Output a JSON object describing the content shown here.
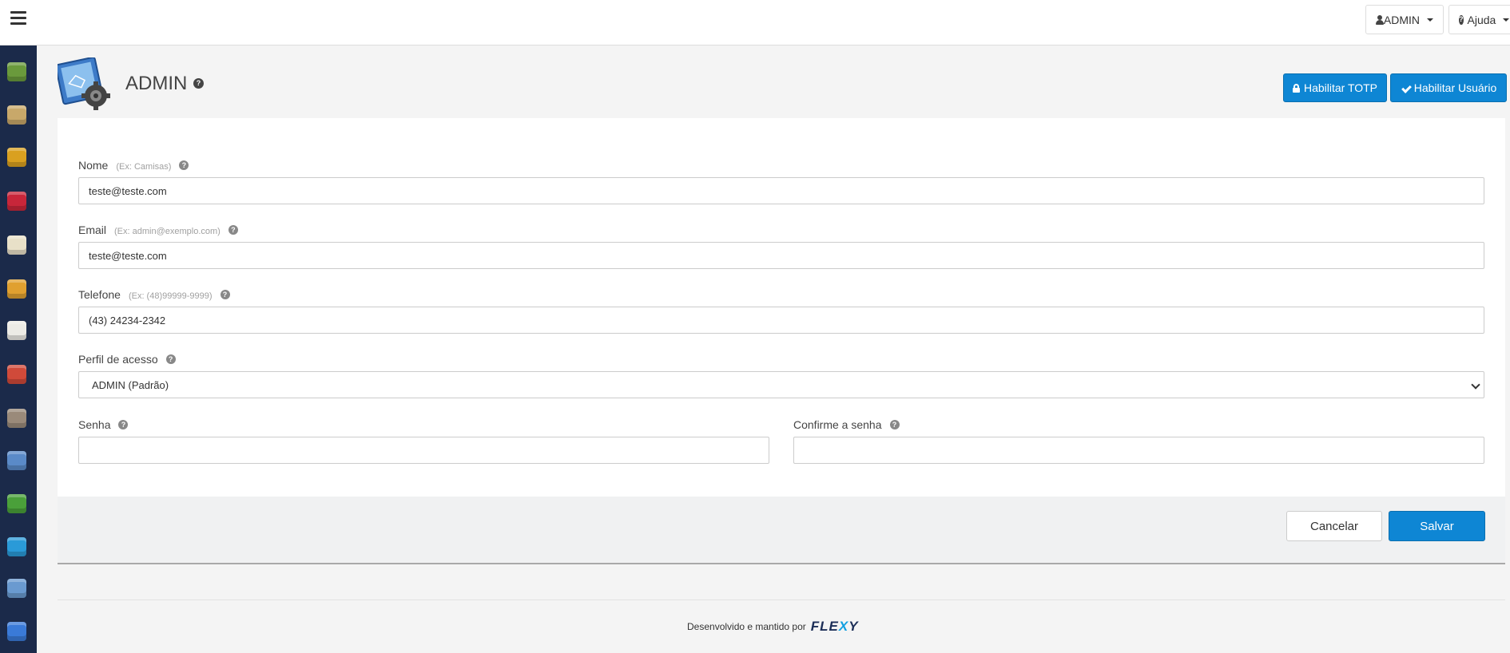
{
  "topbar": {
    "admin_label": "ADMIN",
    "help_label": "Ajuda"
  },
  "header": {
    "title": "ADMIN",
    "totp_button": "Habilitar TOTP",
    "enable_user_button": "Habilitar Usuário"
  },
  "form": {
    "nome": {
      "label": "Nome",
      "hint": "(Ex: Camisas)",
      "value": "teste@teste.com"
    },
    "email": {
      "label": "Email",
      "hint": "(Ex: admin@exemplo.com)",
      "value": "teste@teste.com"
    },
    "telefone": {
      "label": "Telefone",
      "hint": "(Ex: (48)99999-9999)",
      "value": "(43) 24234-2342"
    },
    "perfil": {
      "label": "Perfil de acesso",
      "value": "ADMIN (Padrão)"
    },
    "senha": {
      "label": "Senha",
      "value": ""
    },
    "confirme": {
      "label": "Confirme a senha",
      "value": ""
    }
  },
  "actions": {
    "cancel": "Cancelar",
    "save": "Salvar"
  },
  "footer": {
    "text": "Desenvolvido e mantido por",
    "brand_a": "FLE",
    "brand_x": "X",
    "brand_b": "Y"
  },
  "sidebar_icons": [
    {
      "name": "box-green-icon",
      "color": "#6a9a3c"
    },
    {
      "name": "document-map-icon",
      "color": "#c8a86a"
    },
    {
      "name": "stack-icon",
      "color": "#d9a020"
    },
    {
      "name": "discount-icon",
      "color": "#c8263a"
    },
    {
      "name": "card-icon",
      "color": "#e8e0c8"
    },
    {
      "name": "truck-icon",
      "color": "#e0a030"
    },
    {
      "name": "note-icon",
      "color": "#ecebe6"
    },
    {
      "name": "users-icon",
      "color": "#d04a3a"
    },
    {
      "name": "person-icon",
      "color": "#9a8a7a"
    },
    {
      "name": "cash-register-icon",
      "color": "#5a8ac8"
    },
    {
      "name": "chart-icon",
      "color": "#4aa03a"
    },
    {
      "name": "share-icon",
      "color": "#2a9ad8"
    },
    {
      "name": "settings-screen-icon",
      "color": "#6a9ad0"
    },
    {
      "name": "help-book-icon",
      "color": "#3a7ad8"
    }
  ]
}
